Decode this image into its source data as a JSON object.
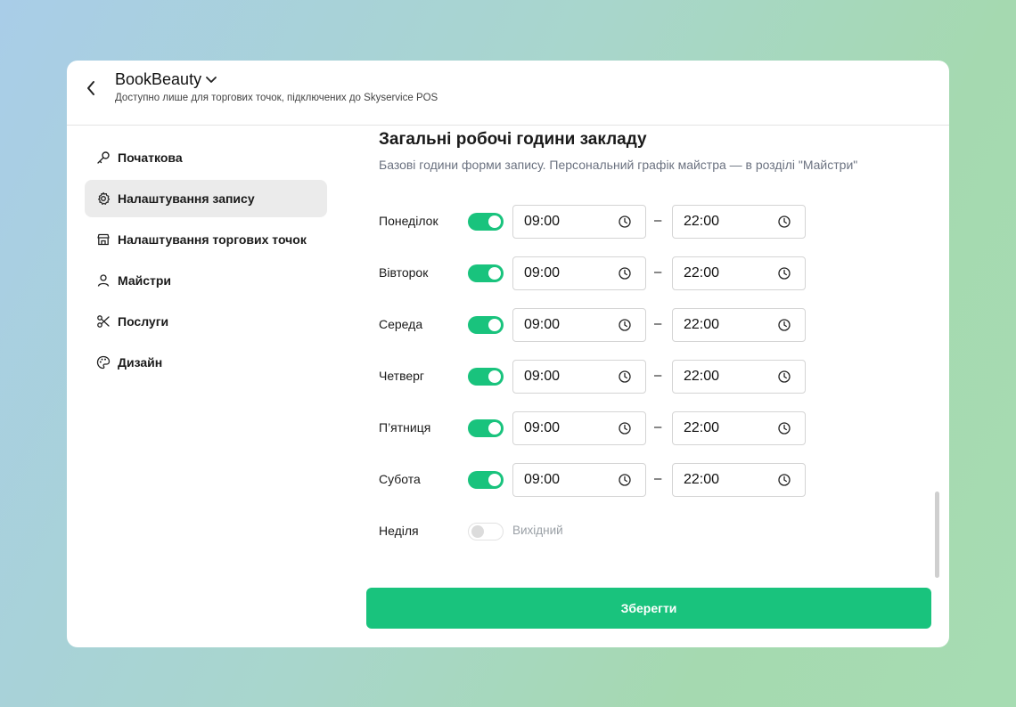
{
  "header": {
    "app_name": "BookBeauty",
    "subtitle": "Доступно лише для торгових точок, підключених до Skyservice POS"
  },
  "sidebar": {
    "items": [
      {
        "label": "Початкова",
        "icon": "key-icon",
        "active": false
      },
      {
        "label": "Налаштування запису",
        "icon": "gear-icon",
        "active": true
      },
      {
        "label": "Налаштування торгових точок",
        "icon": "store-icon",
        "active": false
      },
      {
        "label": "Майстри",
        "icon": "user-icon",
        "active": false
      },
      {
        "label": "Послуги",
        "icon": "scissors-icon",
        "active": false
      },
      {
        "label": "Дизайн",
        "icon": "palette-icon",
        "active": false
      }
    ]
  },
  "main": {
    "title": "Загальні робочі години закладу",
    "description": "Базові години форми запису. Персональний графік майстра — в розділі \"Майстри\"",
    "separator": "–",
    "day_off_label": "Вихідний",
    "days": [
      {
        "name": "Понеділок",
        "enabled": true,
        "from": "09:00",
        "to": "22:00"
      },
      {
        "name": "Вівторок",
        "enabled": true,
        "from": "09:00",
        "to": "22:00"
      },
      {
        "name": "Середа",
        "enabled": true,
        "from": "09:00",
        "to": "22:00"
      },
      {
        "name": "Четверг",
        "enabled": true,
        "from": "09:00",
        "to": "22:00"
      },
      {
        "name": "П’ятниця",
        "enabled": true,
        "from": "09:00",
        "to": "22:00"
      },
      {
        "name": "Субота",
        "enabled": true,
        "from": "09:00",
        "to": "22:00"
      },
      {
        "name": "Неділя",
        "enabled": false
      }
    ],
    "save_label": "Зберегти"
  },
  "colors": {
    "accent": "#19c37d",
    "active_nav_bg": "#ebebeb",
    "muted_text": "#6b7280"
  }
}
